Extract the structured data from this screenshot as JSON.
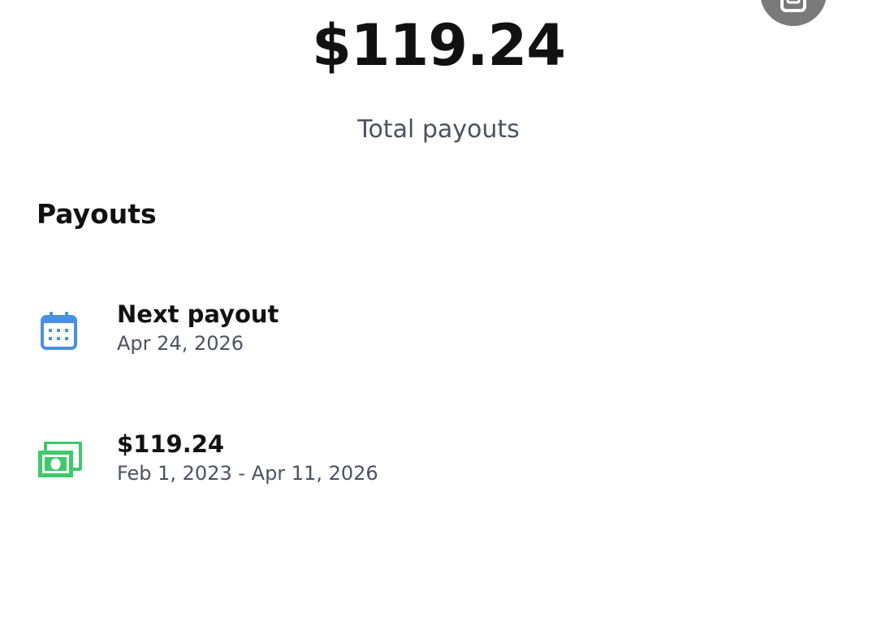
{
  "header": {
    "total_amount": "$119.24",
    "total_label": "Total payouts",
    "action_icon": "square-button-icon"
  },
  "payouts": {
    "section_title": "Payouts",
    "items": [
      {
        "icon": "calendar-icon",
        "icon_color": "#4a90e2",
        "title": "Next payout",
        "subtitle": "Apr 24, 2026"
      },
      {
        "icon": "money-bills-icon",
        "icon_color": "#3ec96b",
        "title": "$119.24",
        "subtitle": "Feb 1, 2023 - Apr 11, 2026"
      }
    ]
  },
  "colors": {
    "primary_text": "#111111",
    "secondary_text": "#4a5360",
    "fab_background": "#7a7a7a"
  }
}
